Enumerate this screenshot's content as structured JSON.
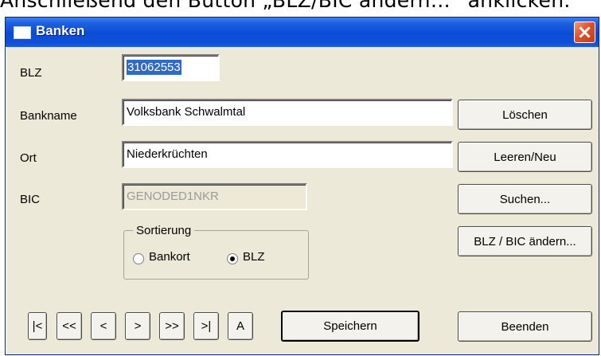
{
  "caption": "Anschließend den Button „BLZ/BIC ändern…“ anklicken.",
  "window": {
    "title": "Banken"
  },
  "fields": {
    "blz": {
      "label": "BLZ",
      "value": "31062553"
    },
    "bankname": {
      "label": "Bankname",
      "value": "Volksbank Schwalmtal"
    },
    "ort": {
      "label": "Ort",
      "value": "Niederkrüchten"
    },
    "bic": {
      "label": "BIC",
      "value": "GENODED1NKR"
    }
  },
  "side_buttons": {
    "loeschen": "Löschen",
    "leeren_neu": "Leeren/Neu",
    "suchen": "Suchen...",
    "blz_bic_aendern": "BLZ / BIC ändern..."
  },
  "sort": {
    "legend": "Sortierung",
    "options": [
      "Bankort",
      "BLZ"
    ],
    "selected": "BLZ"
  },
  "nav_buttons": {
    "first": "|<",
    "prev_page": "<<",
    "prev": "<",
    "next": ">",
    "next_page": ">>",
    "last": ">|",
    "a": "A"
  },
  "footer_buttons": {
    "save": "Speichern",
    "close": "Beenden"
  },
  "colors": {
    "titlebar": "#0a4cd6",
    "dialog_bg": "#ece9d8",
    "selection": "#316ac5",
    "close_button": "#e0502a"
  }
}
